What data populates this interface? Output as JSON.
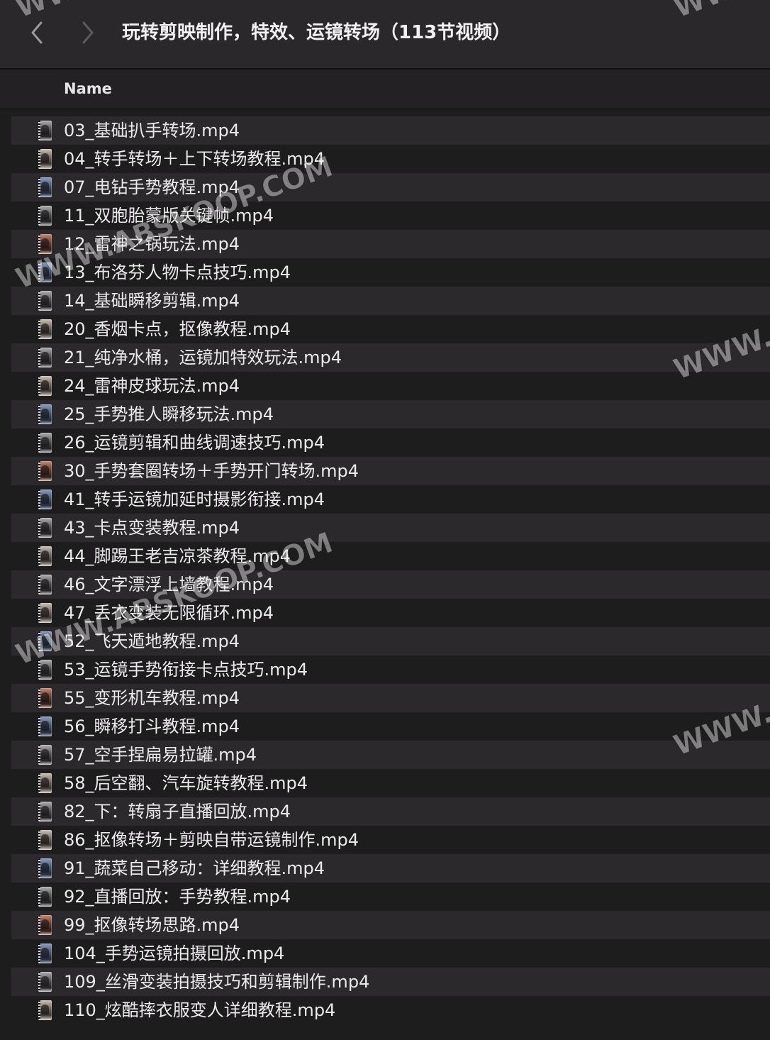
{
  "window": {
    "title": "玩转剪映制作，特效、运镜转场（113节视频）",
    "back_icon": "chevron-left-icon",
    "forward_icon": "chevron-right-icon"
  },
  "columns": {
    "name": "Name"
  },
  "files": [
    "03_基础扒手转场.mp4",
    "04_转手转场＋上下转场教程.mp4",
    "07_电钻手势教程.mp4",
    "11_双胞胎蒙版关键帧.mp4",
    "12_雷神之锅玩法.mp4",
    "13_布洛芬人物卡点技巧.mp4",
    "14_基础瞬移剪辑.mp4",
    "20_香烟卡点，抠像教程.mp4",
    "21_纯净水桶，运镜加特效玩法.mp4",
    "24_雷神皮球玩法.mp4",
    "25_手势推人瞬移玩法.mp4",
    "26_运镜剪辑和曲线调速技巧.mp4",
    "30_手势套圈转场＋手势开门转场.mp4",
    "41_转手运镜加延时摄影衔接.mp4",
    "43_卡点变装教程.mp4",
    "44_脚踢王老吉凉茶教程.mp4",
    "46_文字漂浮上墙教程.mp4",
    "47_丢衣变装无限循环.mp4",
    "52_飞天遁地教程.mp4",
    "53_运镜手势衔接卡点技巧.mp4",
    "55_变形机车教程.mp4",
    "56_瞬移打斗教程.mp4",
    "57_空手捏扁易拉罐.mp4",
    "58_后空翻、汽车旋转教程.mp4",
    "82_下：转扇子直播回放.mp4",
    "86_抠像转场＋剪映自带运镜制作.mp4",
    "91_蔬菜自己移动：详细教程.mp4",
    "92_直播回放：手势教程.mp4",
    "99_抠像转场思路.mp4",
    "104_手势运镜拍摄回放.mp4",
    "109_丝滑变装拍摄技巧和剪辑制作.mp4",
    "110_炫酷摔衣服变人详细教程.mp4"
  ],
  "watermark": {
    "text": "WWW.ABSKOOP.COM",
    "edge_text": "WWW."
  },
  "colors": {
    "background": "#1e1d1e",
    "titlebar": "#2a282a",
    "row_alt": "#2b292b",
    "text": "#ece9ec"
  }
}
